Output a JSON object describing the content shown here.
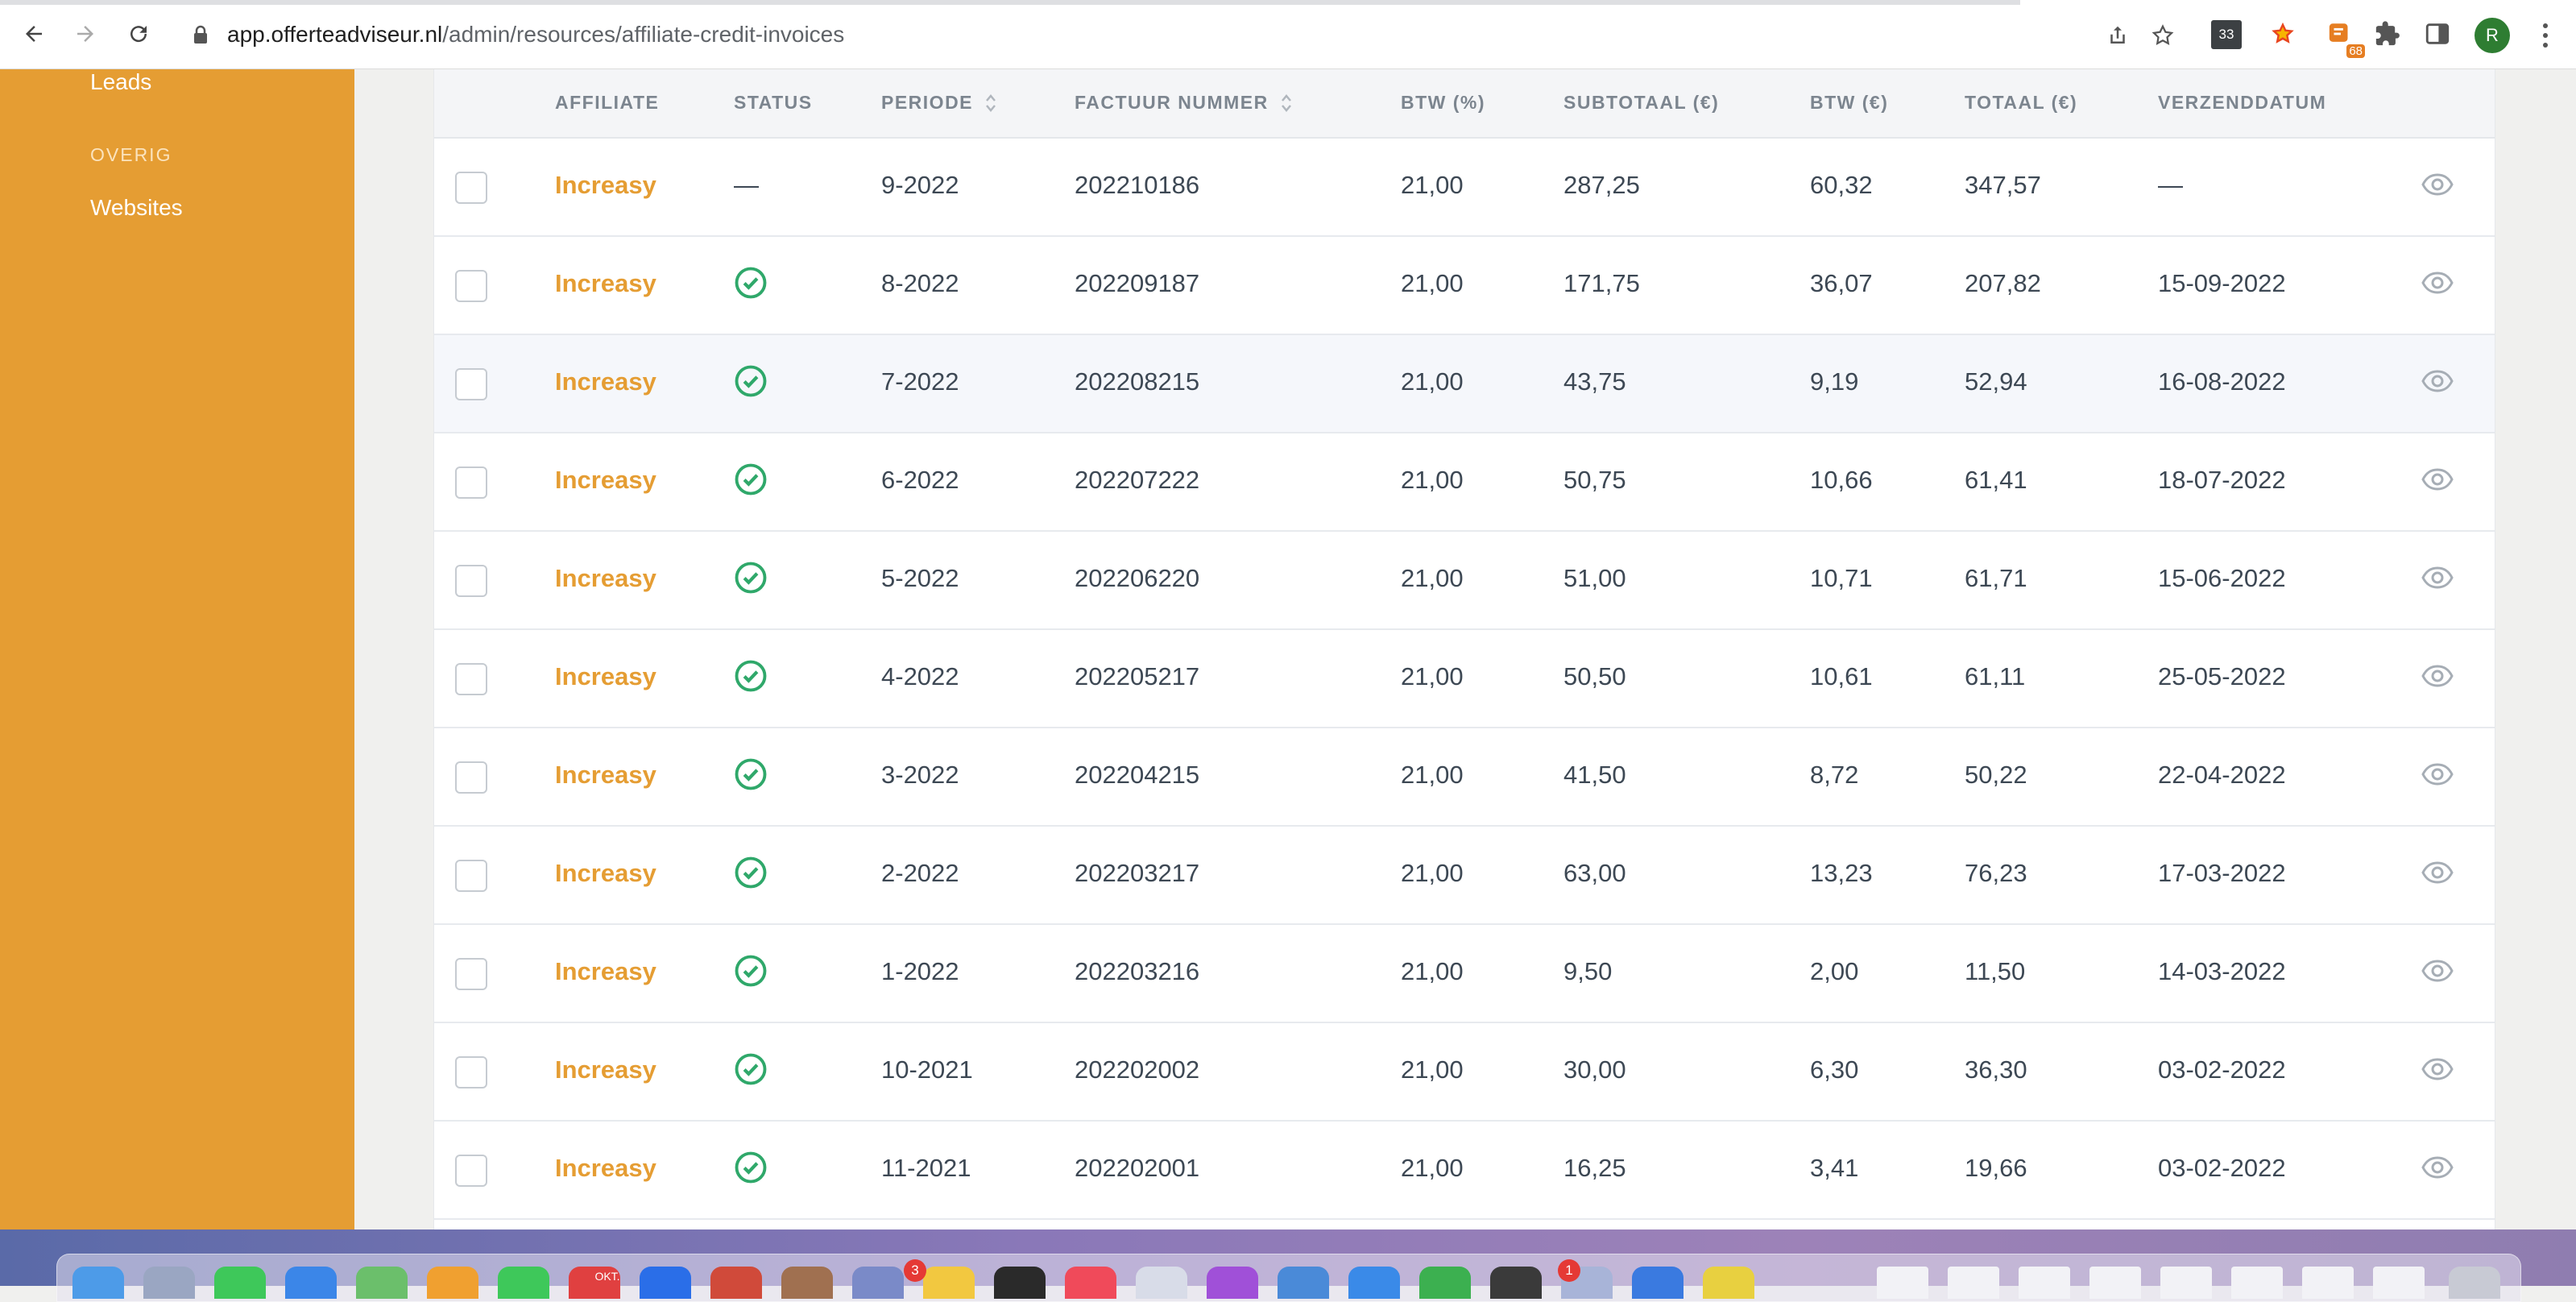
{
  "browser": {
    "url_host": "app.offerteadviseur.nl",
    "url_path": "/admin/resources/affiliate-credit-invoices",
    "extension_badge": "33",
    "extension_count": "68",
    "profile_initial": "R"
  },
  "sidebar": {
    "leads_label": "Leads",
    "overig_heading": "OVERIG",
    "websites_label": "Websites"
  },
  "table": {
    "headers": {
      "affiliate": "AFFILIATE",
      "status": "STATUS",
      "periode": "PERIODE",
      "factuur_nummer": "FACTUUR NUMMER",
      "btw_pct": "BTW (%)",
      "subtotaal": "SUBTOTAAL (€)",
      "btw_eur": "BTW (€)",
      "totaal": "TOTAAL (€)",
      "verzenddatum": "VERZENDDATUM"
    },
    "rows": [
      {
        "affiliate": "Increasy",
        "status": "—",
        "periode": "9-2022",
        "factuur": "202210186",
        "btw_pct": "21,00",
        "subtotaal": "287,25",
        "btw_eur": "60,32",
        "totaal": "347,57",
        "verzenddatum": "—"
      },
      {
        "affiliate": "Increasy",
        "status": "paid",
        "periode": "8-2022",
        "factuur": "202209187",
        "btw_pct": "21,00",
        "subtotaal": "171,75",
        "btw_eur": "36,07",
        "totaal": "207,82",
        "verzenddatum": "15-09-2022"
      },
      {
        "affiliate": "Increasy",
        "status": "paid",
        "periode": "7-2022",
        "factuur": "202208215",
        "btw_pct": "21,00",
        "subtotaal": "43,75",
        "btw_eur": "9,19",
        "totaal": "52,94",
        "verzenddatum": "16-08-2022"
      },
      {
        "affiliate": "Increasy",
        "status": "paid",
        "periode": "6-2022",
        "factuur": "202207222",
        "btw_pct": "21,00",
        "subtotaal": "50,75",
        "btw_eur": "10,66",
        "totaal": "61,41",
        "verzenddatum": "18-07-2022"
      },
      {
        "affiliate": "Increasy",
        "status": "paid",
        "periode": "5-2022",
        "factuur": "202206220",
        "btw_pct": "21,00",
        "subtotaal": "51,00",
        "btw_eur": "10,71",
        "totaal": "61,71",
        "verzenddatum": "15-06-2022"
      },
      {
        "affiliate": "Increasy",
        "status": "paid",
        "periode": "4-2022",
        "factuur": "202205217",
        "btw_pct": "21,00",
        "subtotaal": "50,50",
        "btw_eur": "10,61",
        "totaal": "61,11",
        "verzenddatum": "25-05-2022"
      },
      {
        "affiliate": "Increasy",
        "status": "paid",
        "periode": "3-2022",
        "factuur": "202204215",
        "btw_pct": "21,00",
        "subtotaal": "41,50",
        "btw_eur": "8,72",
        "totaal": "50,22",
        "verzenddatum": "22-04-2022"
      },
      {
        "affiliate": "Increasy",
        "status": "paid",
        "periode": "2-2022",
        "factuur": "202203217",
        "btw_pct": "21,00",
        "subtotaal": "63,00",
        "btw_eur": "13,23",
        "totaal": "76,23",
        "verzenddatum": "17-03-2022"
      },
      {
        "affiliate": "Increasy",
        "status": "paid",
        "periode": "1-2022",
        "factuur": "202203216",
        "btw_pct": "21,00",
        "subtotaal": "9,50",
        "btw_eur": "2,00",
        "totaal": "11,50",
        "verzenddatum": "14-03-2022"
      },
      {
        "affiliate": "Increasy",
        "status": "paid",
        "periode": "10-2021",
        "factuur": "202202002",
        "btw_pct": "21,00",
        "subtotaal": "30,00",
        "btw_eur": "6,30",
        "totaal": "36,30",
        "verzenddatum": "03-02-2022"
      },
      {
        "affiliate": "Increasy",
        "status": "paid",
        "periode": "11-2021",
        "factuur": "202202001",
        "btw_pct": "21,00",
        "subtotaal": "16,25",
        "btw_eur": "3,41",
        "totaal": "19,66",
        "verzenddatum": "03-02-2022"
      }
    ]
  },
  "dock": {
    "mail_badge": "3",
    "app_badge": "1",
    "calendar_label": "OKT."
  },
  "colors": {
    "accent": "#e59d33",
    "status_ok": "#2fa86a"
  }
}
